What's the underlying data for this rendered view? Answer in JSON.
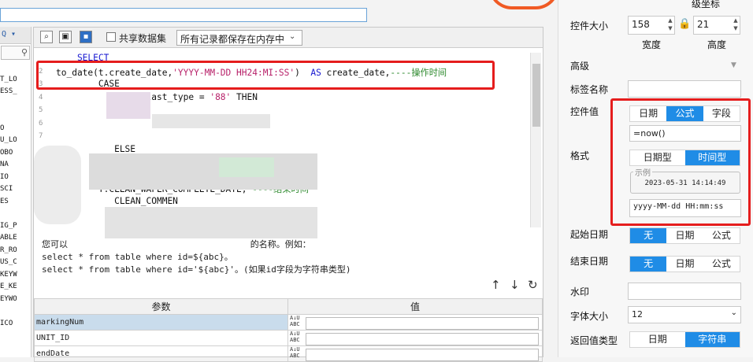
{
  "left_tree": {
    "toolbar_text": "Q ▾",
    "items": [
      "",
      "T_LO",
      "ESS_",
      "",
      "",
      "O",
      "U_LO",
      "OBO",
      "NA",
      "IO",
      "SCI",
      "ES",
      "",
      "IG_P",
      "ABLE",
      "R_RO",
      "US_C",
      "KEYW",
      "E_KE",
      "EYWO",
      "",
      "ICO"
    ]
  },
  "toolbar": {
    "share_label": "共享数据集",
    "mode_value": "所有记录都保存在内存中"
  },
  "code": {
    "lines": [
      {
        "n": "",
        "parts": [
          {
            "t": "    SELECT",
            "c": "kw"
          }
        ]
      },
      {
        "n": "2",
        "parts": [
          {
            "t": "to_date(t.create_date,",
            "c": ""
          },
          {
            "t": "'YYYY-MM-DD HH24:MI:SS'",
            "c": "st"
          },
          {
            "t": ")  ",
            "c": ""
          },
          {
            "t": "AS",
            "c": "kw"
          },
          {
            "t": " create_date,",
            "c": ""
          },
          {
            "t": "----操作时间",
            "c": "cm"
          }
        ]
      },
      {
        "n": "3",
        "parts": [
          {
            "t": "        CASE",
            "c": ""
          }
        ]
      },
      {
        "n": "4",
        "parts": [
          {
            "t": "                 last_type = ",
            "c": ""
          },
          {
            "t": "'88'",
            "c": "st"
          },
          {
            "t": " THEN",
            "c": ""
          }
        ]
      },
      {
        "n": "5",
        "parts": []
      },
      {
        "n": "6",
        "parts": []
      },
      {
        "n": "7",
        "parts": []
      },
      {
        "n": "",
        "parts": [
          {
            "t": "           ELSE",
            "c": ""
          }
        ]
      },
      {
        "n": "",
        "parts": []
      },
      {
        "n": "",
        "parts": [
          {
            "t": "                                   时间",
            "c": "cm"
          }
        ]
      },
      {
        "n": "",
        "parts": [
          {
            "t": "        T.CLEAN_WAFER_COMPLETE_DATE, ",
            "c": ""
          },
          {
            "t": "----结束时间",
            "c": "cm"
          }
        ]
      },
      {
        "n": "",
        "parts": [
          {
            "t": "           CLEAN_COMMEN",
            "c": ""
          }
        ]
      }
    ]
  },
  "help": {
    "line1": "您可以                                   的名称。例如：",
    "line2": "select * from table where id=${abc}。",
    "line3": "select * from table where id='${abc}'。(如果id字段为字符串类型)"
  },
  "params": {
    "col_param": "参数",
    "col_value": "值",
    "rows": [
      "markingNum",
      "UNIT_ID",
      "endDate"
    ],
    "abc_icon": "A↓U ABC"
  },
  "right_panel": {
    "top_cut": "级坐标",
    "size_label": "控件大小",
    "width_value": "158",
    "height_value": "21",
    "width_label": "宽度",
    "height_label": "高度",
    "advanced_label": "高级",
    "tag_name_label": "标签名称",
    "tag_name_value": "",
    "control_value_label": "控件值",
    "cv_tabs": [
      "日期",
      "公式",
      "字段"
    ],
    "cv_selected": 1,
    "formula_value": "=now()",
    "format_label": "格式",
    "fmt_tabs": [
      "日期型",
      "时间型"
    ],
    "fmt_selected": 1,
    "example_legend": "示例",
    "example_value": "2023-05-31 14:14:49",
    "format_value": "yyyy-MM-dd HH:mm:ss",
    "start_label": "起始日期",
    "end_label": "结束日期",
    "range_tabs": [
      "无",
      "日期",
      "公式"
    ],
    "range_selected": 0,
    "watermark_label": "水印",
    "watermark_value": "",
    "font_size_label": "字体大小",
    "font_size_value": "12",
    "return_type_label": "返回值类型",
    "return_tabs": [
      "日期",
      "字符串"
    ],
    "return_selected": 1
  },
  "colors": {
    "accent": "#1f8ce6",
    "highlight": "#e51d1d",
    "keyword": "#1515d0",
    "string": "#b8226a",
    "comment": "#2f8a2f"
  }
}
